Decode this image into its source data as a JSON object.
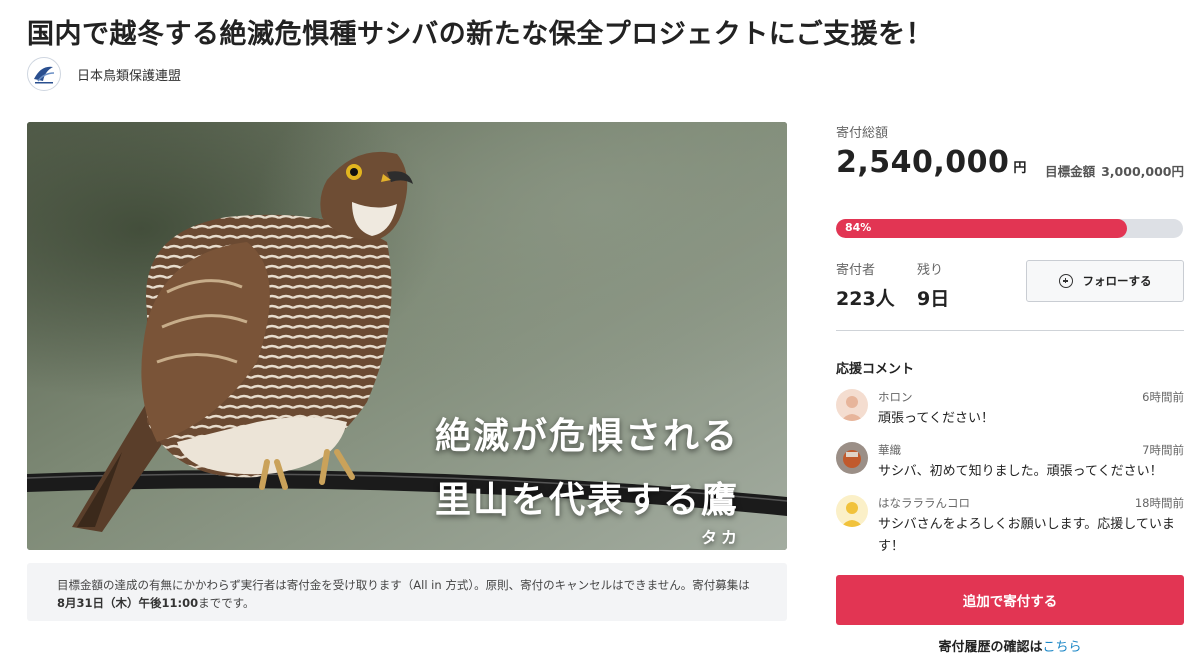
{
  "page": {
    "title": "国内で越冬する絶滅危惧種サシバの新たな保全プロジェクトにご支援を！"
  },
  "organization": {
    "name": "日本鳥類保護連盟",
    "logo_icon": "bird-logo-icon"
  },
  "hero": {
    "line1": "絶滅が危惧される",
    "line2": "里山を代表する鷹",
    "ruby": "タカ"
  },
  "notice": {
    "text_before": "目標金額の達成の有無にかかわらず実行者は寄付金を受け取ります（All in 方式）。原則、寄付のキャンセルはできません。寄付募集は",
    "deadline": "8月31日（木）午後11:00",
    "text_after": "までです。"
  },
  "funding": {
    "total_label": "寄付総額",
    "total_amount": "2,540,000",
    "currency": "円",
    "goal_label": "目標金額",
    "goal_amount": "3,000,000円",
    "progress_text": "84%",
    "progress_fraction": 0.84,
    "progress_color": "#e23553"
  },
  "stats": {
    "donors_label": "寄付者",
    "donors_value": "223人",
    "remaining_label": "残り",
    "remaining_value": "9日"
  },
  "follow_button": {
    "label": "フォローする",
    "icon": "plus-circle-icon"
  },
  "comments": {
    "title": "応援コメント",
    "items": [
      {
        "name": "ホロン",
        "time": "6時間前",
        "text": "頑張ってください！",
        "avatar": "person-avatar-icon"
      },
      {
        "name": "華織",
        "time": "7時間前",
        "text": "サシバ、初めて知りました。頑張ってください！",
        "avatar": "photo-avatar"
      },
      {
        "name": "はなラララんコロ",
        "time": "18時間前",
        "text": "サシバさんをよろしくお願いします。応援しています！",
        "avatar": "person-avatar-icon"
      }
    ]
  },
  "donate_button": {
    "label": "追加で寄付する",
    "color": "#e23553"
  },
  "history": {
    "label": "寄付履歴の確認は",
    "link": "こちら"
  }
}
